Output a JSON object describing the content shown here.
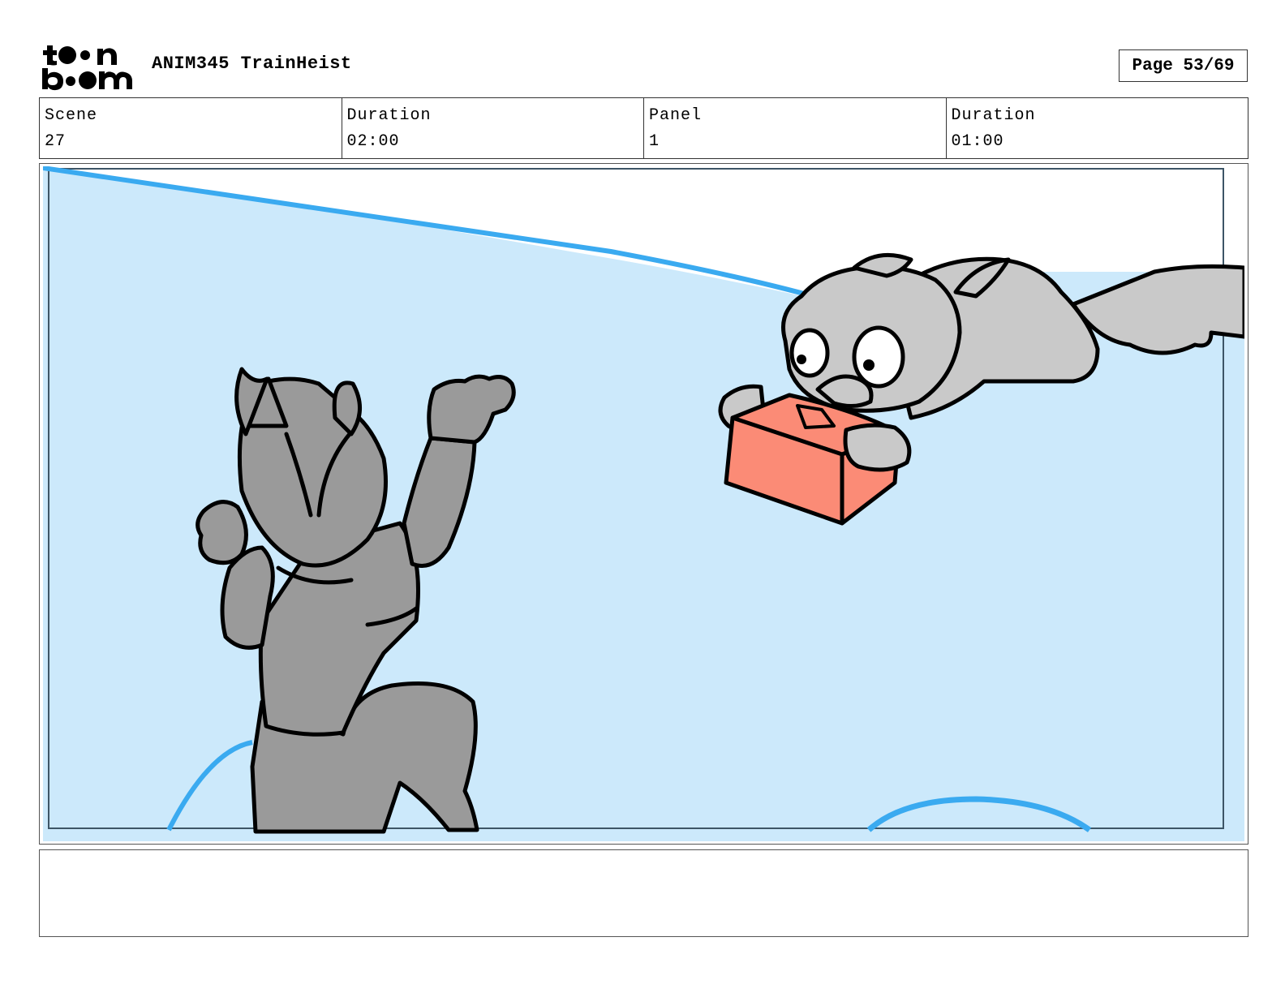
{
  "header": {
    "logo_text": "toon boom",
    "project_title": "ANIM345 TrainHeist",
    "page_label": "Page 53/69"
  },
  "info": {
    "scene_label": "Scene",
    "scene_value": "27",
    "scene_duration_label": "Duration",
    "scene_duration_value": "02:00",
    "panel_label": "Panel",
    "panel_value": "1",
    "panel_duration_label": "Duration",
    "panel_duration_value": "01:00"
  },
  "panel": {
    "art_icon": "storyboard-sketch",
    "sky_color": "#cce9fb",
    "line_blue": "#3aaaf0",
    "character_dark": "#9a9a9a",
    "character_light": "#c9c9c9",
    "box_color": "#fb8b76"
  },
  "notes": {
    "text": ""
  }
}
